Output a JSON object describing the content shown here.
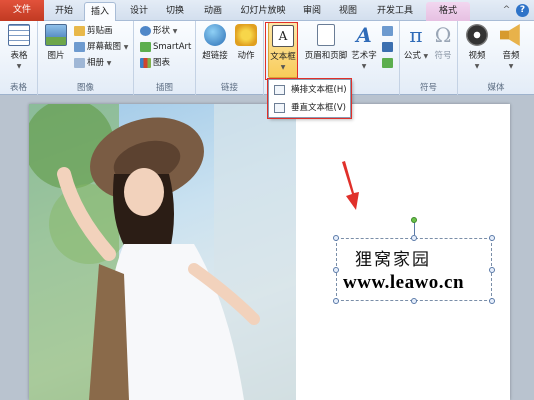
{
  "tabs": [
    {
      "label": "文件"
    },
    {
      "label": "开始"
    },
    {
      "label": "插入"
    },
    {
      "label": "设计"
    },
    {
      "label": "切换"
    },
    {
      "label": "动画"
    },
    {
      "label": "幻灯片放映"
    },
    {
      "label": "审阅"
    },
    {
      "label": "视图"
    },
    {
      "label": "开发工具"
    },
    {
      "label": "格式"
    }
  ],
  "window_icons": {
    "minimize": "^",
    "help": "?"
  },
  "ribbon": {
    "groups": {
      "tables": "表格",
      "images": "图像",
      "illustrations": "插图",
      "links": "链接",
      "symbols": "符号",
      "media": "媒体"
    },
    "table_btn": "表格",
    "picture_btn": "图片",
    "clipart_btn": "剪贴画",
    "screenshot_btn": "屏幕截图",
    "album_btn": "相册",
    "shapes_btn": "形状",
    "smartart_btn": "SmartArt",
    "chart_btn": "图表",
    "hyperlink_btn": "超链接",
    "action_btn": "动作",
    "textbox_btn": "文本框",
    "headerfooter_btn": "页眉和页脚",
    "wordart_btn": "艺术字",
    "equation_btn": "公式",
    "symbol_btn": "符号",
    "video_btn": "视频",
    "audio_btn": "音频"
  },
  "dropdown": {
    "horizontal": "横排文本框(H)",
    "vertical": "垂直文本框(V)"
  },
  "slide": {
    "line1": "狸窝家园",
    "line2": "www.leawo.cn"
  },
  "colors": {
    "file_tab": "#d0452e",
    "highlight": "#e0302a",
    "accent": "#2e73c8"
  },
  "icons": [
    "table-icon",
    "picture-icon",
    "clipart-icon",
    "screenshot-icon",
    "album-icon",
    "shapes-icon",
    "smartart-icon",
    "chart-icon",
    "hyperlink-icon",
    "action-icon",
    "textbox-icon",
    "headerfooter-icon",
    "wordart-icon",
    "equation-icon",
    "symbol-icon",
    "video-icon",
    "audio-icon",
    "arrow-icon"
  ]
}
